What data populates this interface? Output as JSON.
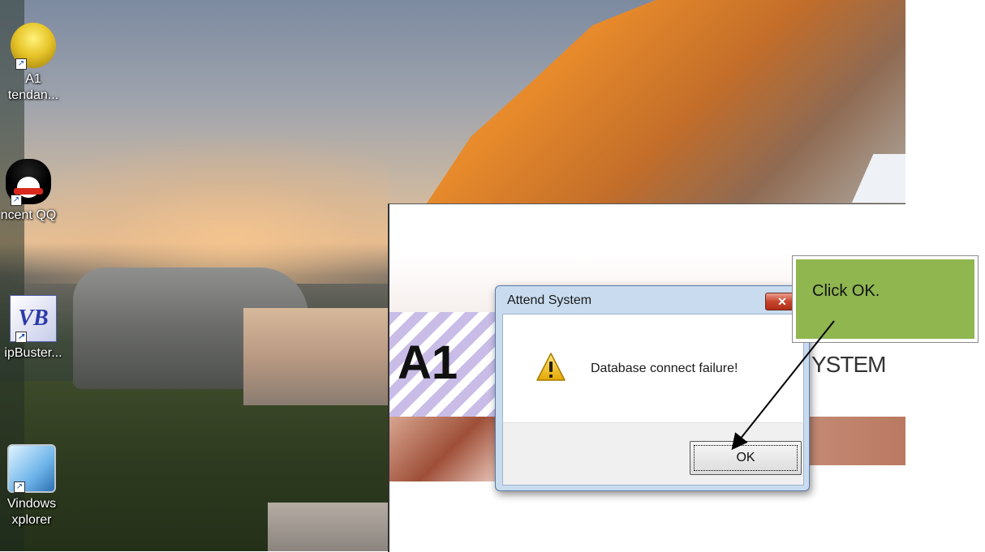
{
  "desktop": {
    "icons": [
      {
        "label": "A1\ntendan...",
        "icon": "coins-icon"
      },
      {
        "label": "ncent QQ",
        "icon": "penguin-icon"
      },
      {
        "label": "ipBuster...",
        "icon": "vb-icon"
      },
      {
        "label": "Vindows\nxplorer",
        "icon": "computer-icon"
      }
    ]
  },
  "app": {
    "logo_text": "A1",
    "system_text": "YSTEM"
  },
  "dialog": {
    "title": "Attend System",
    "close_label": "✕",
    "message": "Database connect failure!",
    "ok_label": "OK"
  },
  "callout": {
    "text": "Click OK."
  },
  "colors": {
    "callout_bg": "#8fb64f",
    "close_red": "#c8452c"
  }
}
